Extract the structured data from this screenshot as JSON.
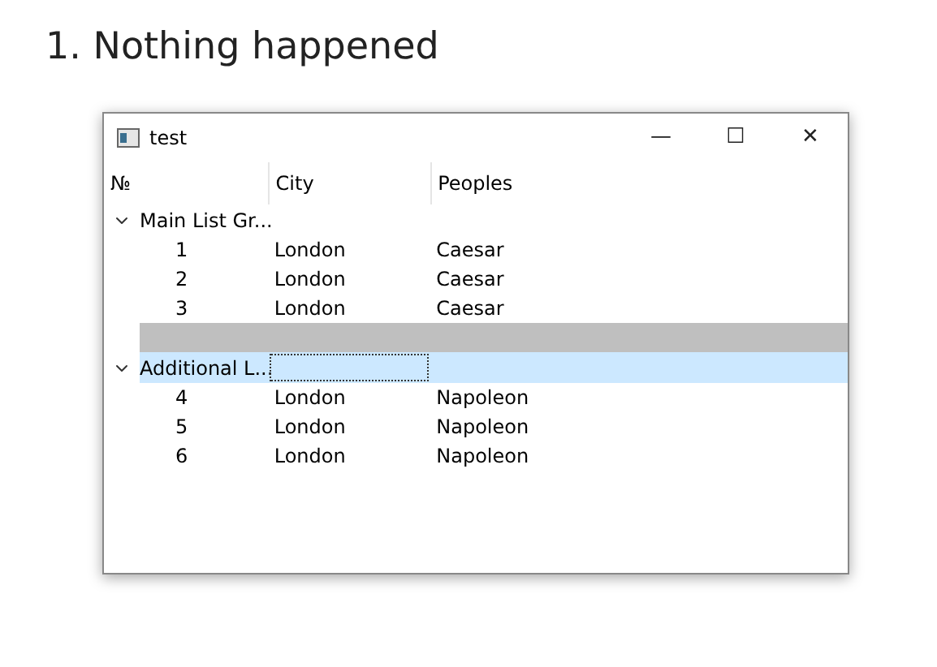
{
  "heading": "1. Nothing happened",
  "window": {
    "title": "test",
    "controls": [
      "—",
      "☐",
      "✕"
    ]
  },
  "table": {
    "columns": [
      "№",
      "City",
      "Peoples"
    ],
    "items": [
      {
        "kind": "group",
        "title": "Main List Gr...",
        "expanded": true,
        "selected": false,
        "rows": [
          [
            "1",
            "London",
            "Caesar"
          ],
          [
            "2",
            "London",
            "Caesar"
          ],
          [
            "3",
            "London",
            "Caesar"
          ]
        ]
      },
      {
        "kind": "blank",
        "selected": true
      },
      {
        "kind": "group",
        "title": "Additional L...",
        "expanded": true,
        "selected": true,
        "rows": [
          [
            "4",
            "London",
            "Napoleon"
          ],
          [
            "5",
            "London",
            "Napoleon"
          ],
          [
            "6",
            "London",
            "Napoleon"
          ]
        ]
      }
    ]
  }
}
